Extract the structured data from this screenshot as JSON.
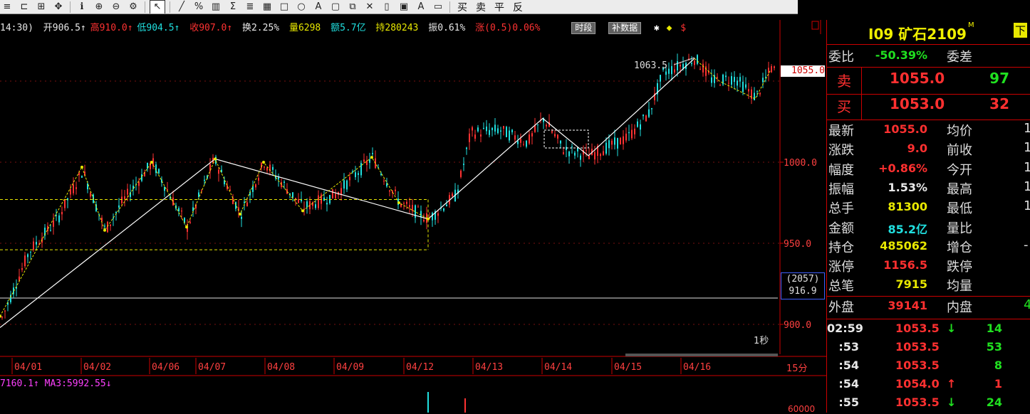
{
  "toolbar": {
    "icons": [
      "menu-icon",
      "bracket-icon",
      "measure-icon",
      "move-icon",
      "info-icon",
      "zoom-in-icon",
      "zoom-out-icon",
      "settings-icon",
      "cursor-icon",
      "line-icon",
      "percent-icon",
      "channel-icon",
      "fib-icon",
      "text-icon",
      "grid-icon",
      "rect-icon",
      "circle-icon",
      "label-icon",
      "lock-icon",
      "copy-icon",
      "close-icon",
      "trash-icon",
      "save-icon",
      "color-icon",
      "style-icon"
    ],
    "trade_buttons": [
      "买",
      "卖",
      "平",
      "反"
    ]
  },
  "infobar": {
    "time": "14:30)",
    "open": "开906.5↑",
    "high": "高910.0↑",
    "low": "低904.5↑",
    "close": "收907.0↑",
    "turnover": "换2.25%",
    "volume": "量6298",
    "amount": "额5.7亿",
    "position": "持280243",
    "amplitude": "振0.61%",
    "change": "涨(0.5)0.06%",
    "btn_period": "时段",
    "btn_fill": "补数据"
  },
  "chart": {
    "y_labels": [
      "1000.0",
      "950.0",
      "900.0"
    ],
    "peak_label": "1063.5",
    "last_price": "1055.0",
    "bar_count": "(2057)",
    "bottom_value": "916.9",
    "seconds": "1秒",
    "period": "15分",
    "dates": [
      "04/01",
      "04/02",
      "04/06",
      "04/07",
      "04/08",
      "04/09",
      "04/12",
      "04/13",
      "04/14",
      "04/15",
      "04/16"
    ],
    "ma_text": "7160.1↑ MA3:5992.55↓",
    "vol_label": "60000"
  },
  "panel": {
    "title": "I09 矿石2109",
    "title_flag": "M",
    "corner": "下",
    "wei_bi": {
      "label": "委比",
      "value": "-50.39%",
      "label2": "委差"
    },
    "sell": {
      "label": "卖",
      "price": "1055.0",
      "qty": "97"
    },
    "buy": {
      "label": "买",
      "price": "1053.0",
      "qty": "32"
    },
    "stats": [
      {
        "label": "最新",
        "value": "1055.0",
        "color": "#ff3030",
        "label2": "均价",
        "v2": "1"
      },
      {
        "label": "涨跌",
        "value": "9.0",
        "color": "#ff3030",
        "label2": "前收",
        "v2": "1"
      },
      {
        "label": "幅度",
        "value": "+0.86%",
        "color": "#ff3030",
        "label2": "今开",
        "v2": "1"
      },
      {
        "label": "振幅",
        "value": "1.53%",
        "color": "#e8e8e8",
        "label2": "最高",
        "v2": "1"
      },
      {
        "label": "总手",
        "value": "81300",
        "color": "#e8e800",
        "label2": "最低",
        "v2": "1"
      },
      {
        "label": "金额",
        "value": "85.2亿",
        "color": "#20e0e0",
        "label2": "量比",
        "v2": ""
      },
      {
        "label": "持仓",
        "value": "485062",
        "color": "#e8e800",
        "label2": "增仓",
        "v2": "-"
      },
      {
        "label": "涨停",
        "value": "1156.5",
        "color": "#ff3030",
        "label2": "跌停",
        "v2": ""
      },
      {
        "label": "总笔",
        "value": "7915",
        "color": "#e8e800",
        "label2": "均量",
        "v2": ""
      }
    ],
    "outer": {
      "label": "外盘",
      "value": "39141",
      "label2": "内盘",
      "v2": "4"
    },
    "ticks": [
      {
        "time": "02:59",
        "price": "1053.5",
        "arrow": "↓",
        "acolor": "#20e020",
        "qty": "14",
        "qcolor": "#20e020"
      },
      {
        "time": ":53",
        "price": "1053.5",
        "arrow": "",
        "acolor": "#20e020",
        "qty": "53",
        "qcolor": "#20e020"
      },
      {
        "time": ":54",
        "price": "1053.5",
        "arrow": "",
        "acolor": "#20e020",
        "qty": "8",
        "qcolor": "#20e020"
      },
      {
        "time": ":54",
        "price": "1054.0",
        "arrow": "↑",
        "acolor": "#ff3030",
        "qty": "1",
        "qcolor": "#ff3030"
      },
      {
        "time": ":55",
        "price": "1053.5",
        "arrow": "↓",
        "acolor": "#20e020",
        "qty": "24",
        "qcolor": "#20e020"
      }
    ]
  },
  "colors": {
    "up": "#ff3232",
    "down": "#20e0e0",
    "zigzag": "#e8e800",
    "trend": "#ffffff"
  }
}
